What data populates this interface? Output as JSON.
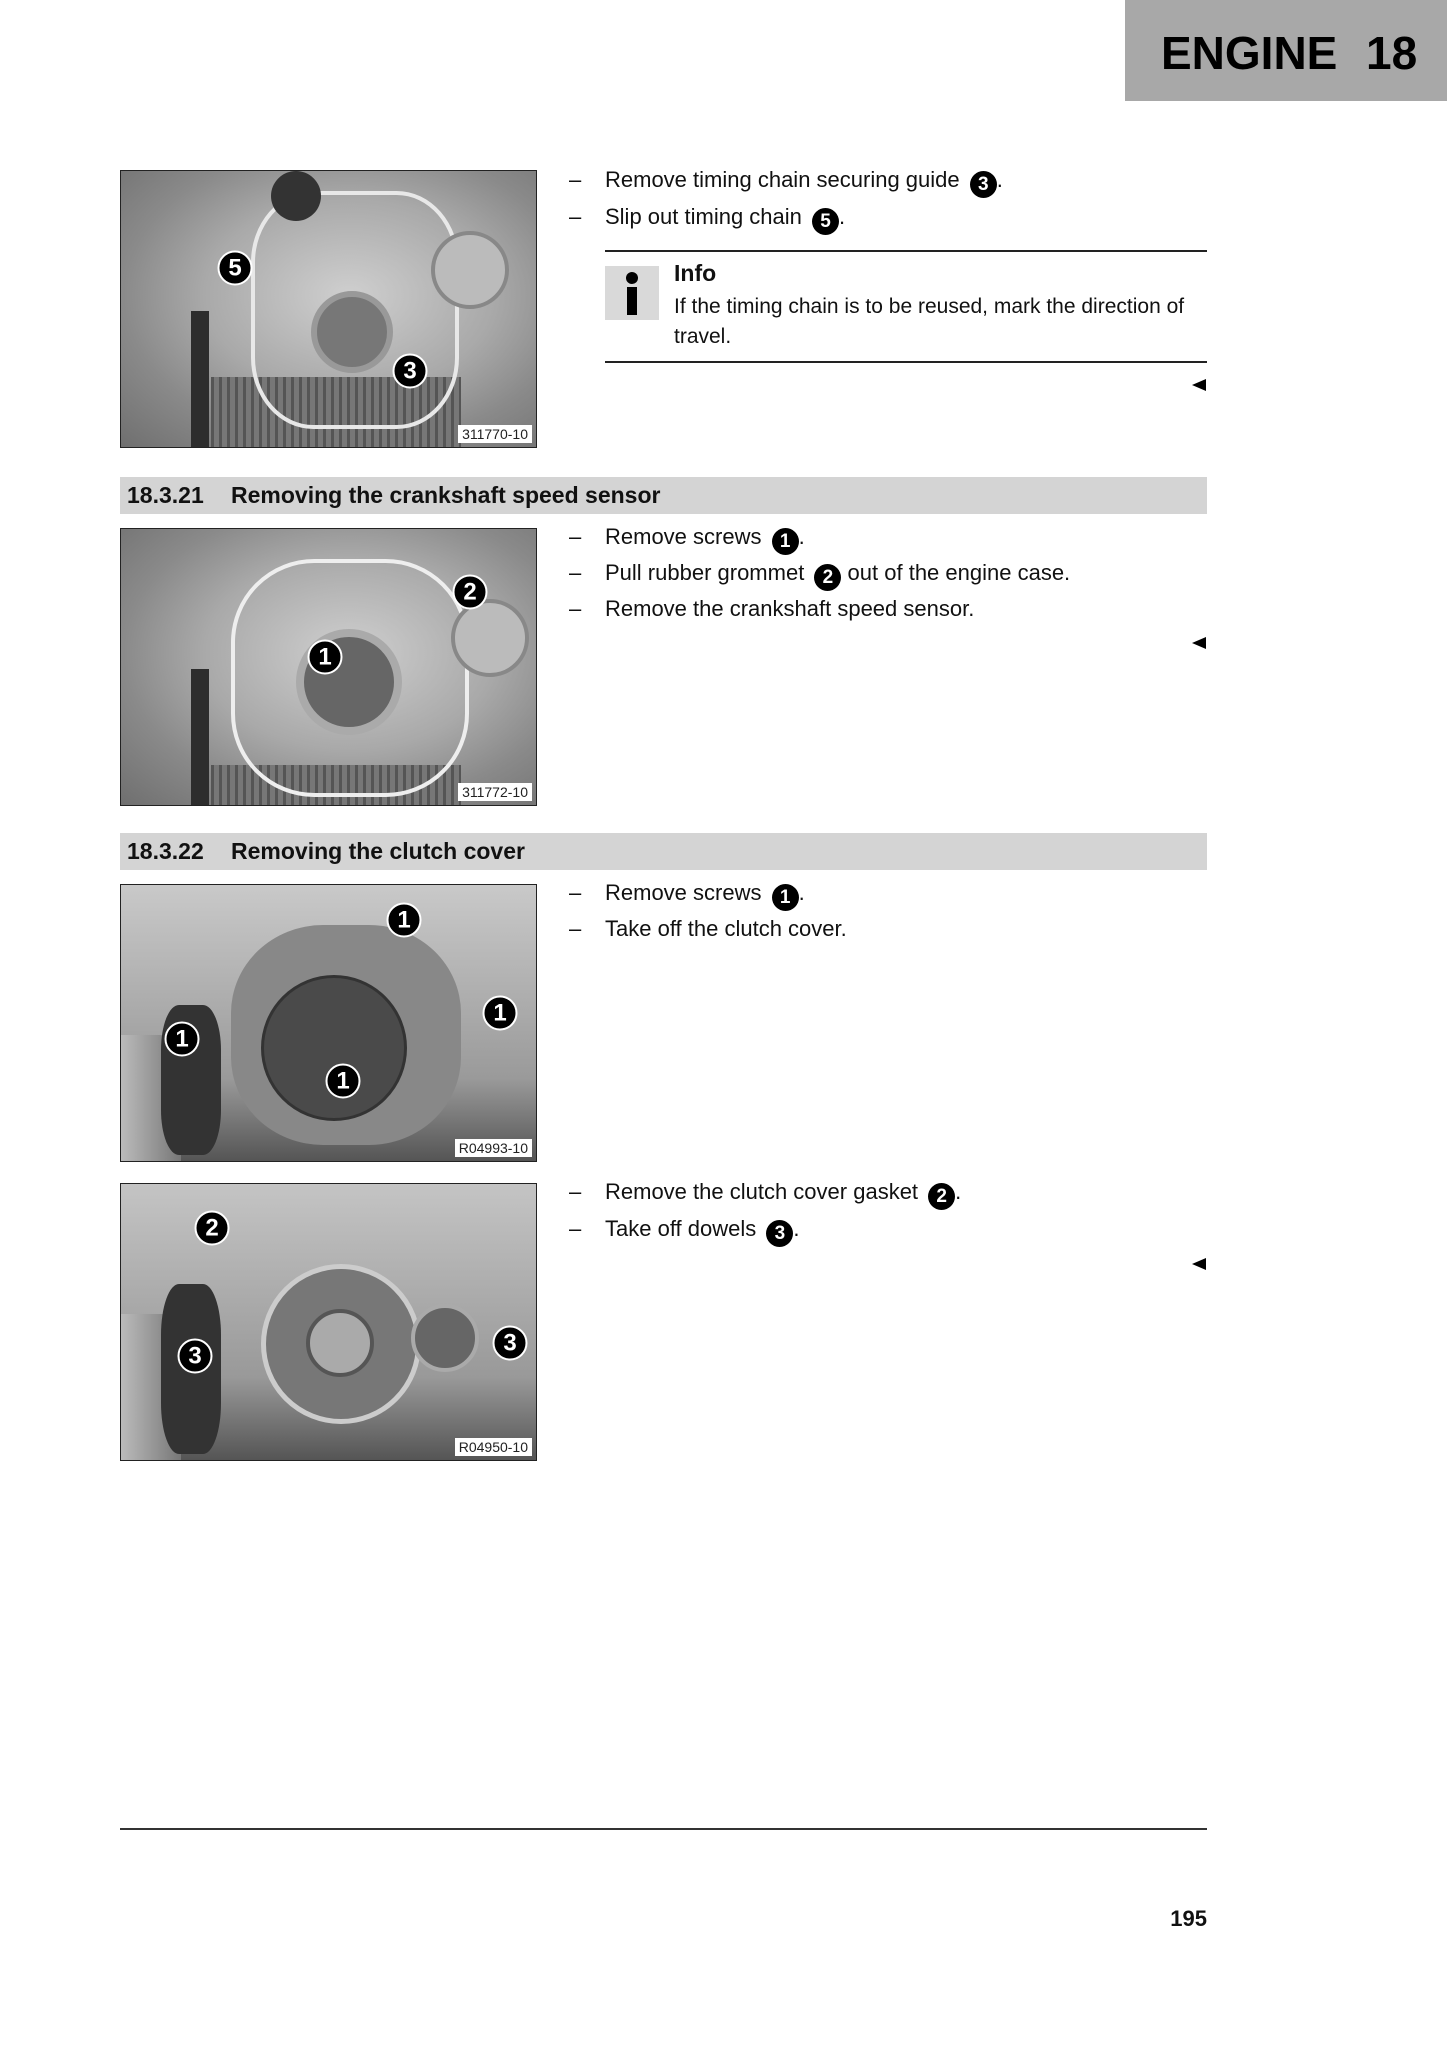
{
  "header": {
    "chapter_title": "ENGINE",
    "chapter_number": "18"
  },
  "blocks": [
    {
      "photo": {
        "label": "311770-10",
        "callouts": [
          "5",
          "3"
        ]
      },
      "steps": [
        {
          "text": "Remove timing chain securing guide",
          "ref": "3",
          "after": "."
        },
        {
          "text": "Slip out timing chain",
          "ref": "5",
          "after": "."
        }
      ],
      "info": {
        "title": "Info",
        "text": "If the timing chain is to be reused, mark the direction of travel."
      }
    },
    {
      "section": {
        "number": "18.3.21",
        "title": "Removing the crankshaft speed sensor"
      },
      "photo": {
        "label": "311772-10",
        "callouts": [
          "2",
          "1"
        ]
      },
      "steps": [
        {
          "text": "Remove screws",
          "ref": "1",
          "after": "."
        },
        {
          "text": "Pull rubber grommet",
          "ref": "2",
          "after": " out of the engine case."
        },
        {
          "text": "Remove the crankshaft speed sensor.",
          "ref": null,
          "after": ""
        }
      ]
    },
    {
      "section": {
        "number": "18.3.22",
        "title": "Removing the clutch cover"
      },
      "photo": {
        "label": "R04993-10",
        "callouts": [
          "1",
          "1",
          "1",
          "1"
        ]
      },
      "steps": [
        {
          "text": "Remove screws",
          "ref": "1",
          "after": "."
        },
        {
          "text": "Take off the clutch cover.",
          "ref": null,
          "after": ""
        }
      ]
    },
    {
      "photo": {
        "label": "R04950-10",
        "callouts": [
          "2",
          "3",
          "3"
        ]
      },
      "steps": [
        {
          "text": "Remove the clutch cover gasket",
          "ref": "2",
          "after": "."
        },
        {
          "text": "Take off dowels",
          "ref": "3",
          "after": "."
        }
      ]
    }
  ],
  "bullet_symbol": "–",
  "footer": {
    "page_number": "195"
  }
}
